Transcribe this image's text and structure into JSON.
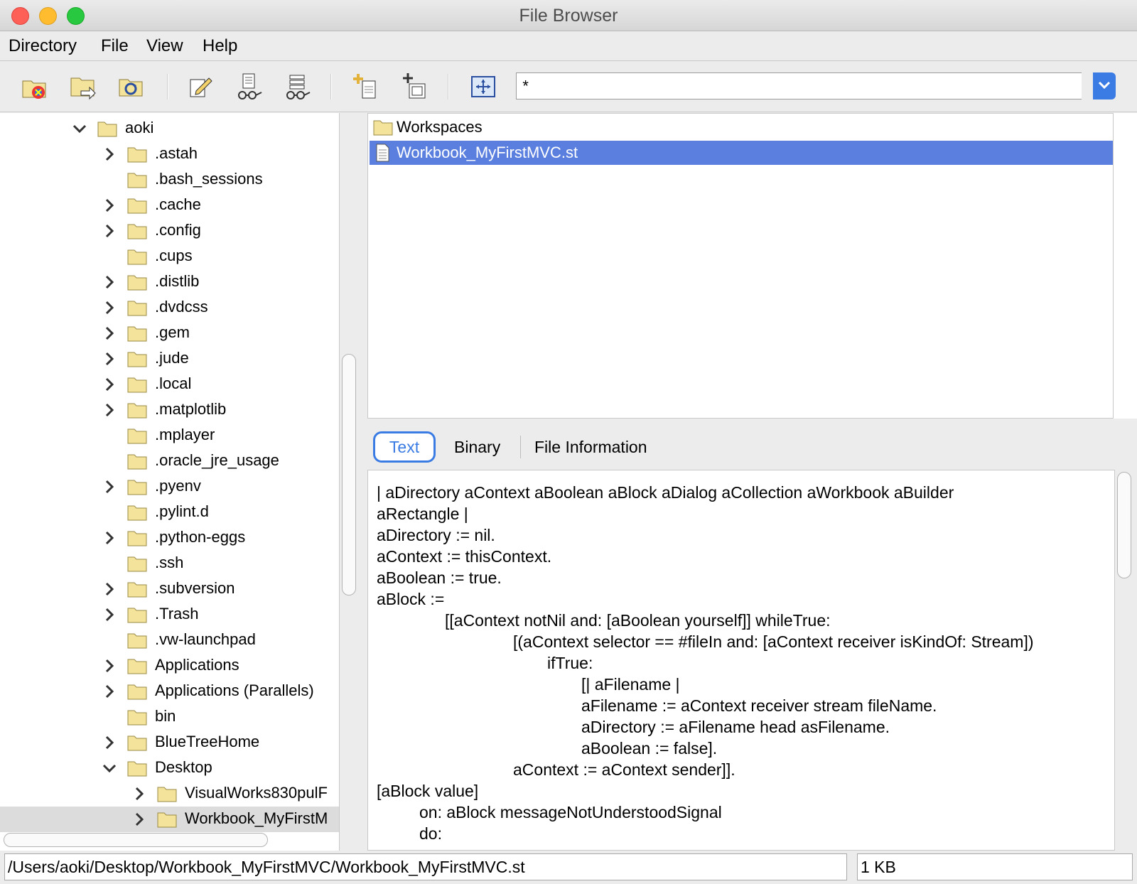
{
  "window": {
    "title": "File Browser"
  },
  "menu": [
    "Directory",
    "File",
    "View",
    "Help"
  ],
  "toolbar": {
    "filter_value": "*",
    "buttons": [
      "favorites-icon",
      "go-directory-icon",
      "refresh-directory-icon",
      "edit-icon",
      "inspect-file-icon",
      "inspect-directory-icon",
      "new-file-icon",
      "new-directory-icon",
      "fit-icon"
    ]
  },
  "tree": {
    "items": [
      {
        "label": "aoki",
        "arrow": "down"
      },
      {
        "label": ".astah",
        "arrow": "right"
      },
      {
        "label": ".bash_sessions",
        "arrow": ""
      },
      {
        "label": ".cache",
        "arrow": "right"
      },
      {
        "label": ".config",
        "arrow": "right"
      },
      {
        "label": ".cups",
        "arrow": ""
      },
      {
        "label": ".distlib",
        "arrow": "right"
      },
      {
        "label": ".dvdcss",
        "arrow": "right"
      },
      {
        "label": ".gem",
        "arrow": "right"
      },
      {
        "label": ".jude",
        "arrow": "right"
      },
      {
        "label": ".local",
        "arrow": "right"
      },
      {
        "label": ".matplotlib",
        "arrow": "right"
      },
      {
        "label": ".mplayer",
        "arrow": ""
      },
      {
        "label": ".oracle_jre_usage",
        "arrow": ""
      },
      {
        "label": ".pyenv",
        "arrow": "right"
      },
      {
        "label": ".pylint.d",
        "arrow": ""
      },
      {
        "label": ".python-eggs",
        "arrow": "right"
      },
      {
        "label": ".ssh",
        "arrow": ""
      },
      {
        "label": ".subversion",
        "arrow": "right"
      },
      {
        "label": ".Trash",
        "arrow": "right"
      },
      {
        "label": ".vw-launchpad",
        "arrow": ""
      },
      {
        "label": "Applications",
        "arrow": "right"
      },
      {
        "label": "Applications (Parallels)",
        "arrow": "right"
      },
      {
        "label": "bin",
        "arrow": ""
      },
      {
        "label": "BlueTreeHome",
        "arrow": "right"
      },
      {
        "label": "Desktop",
        "arrow": "down"
      },
      {
        "label": "VisualWorks830pulF",
        "arrow": "right"
      },
      {
        "label": "Workbook_MyFirstM",
        "arrow": "right",
        "selected": true
      }
    ]
  },
  "files": [
    {
      "label": "Workspaces",
      "type": "folder"
    },
    {
      "label": "Workbook_MyFirstMVC.st",
      "type": "file",
      "selected": true
    }
  ],
  "tabs": {
    "text": "Text",
    "binary": "Binary",
    "info": "File Information"
  },
  "code_lines": [
    "| aDirectory aContext aBoolean aBlock aDialog aCollection aWorkbook aBuilder",
    "aRectangle |",
    "aDirectory := nil.",
    "aContext := thisContext.",
    "aBoolean := true.",
    "aBlock :=",
    "[[aContext notNil and: [aBoolean yourself]] whileTrue:",
    "[(aContext selector == #fileIn and: [aContext receiver isKindOf: Stream])",
    "ifTrue:",
    "[| aFilename |",
    "aFilename := aContext receiver stream fileName.",
    "aDirectory := aFilename head asFilename.",
    "aBoolean := false].",
    "aContext := aContext sender]].",
    "[aBlock value]",
    "on: aBlock messageNotUnderstoodSignal",
    "do:"
  ],
  "status": {
    "path": "/Users/aoki/Desktop/Workbook_MyFirstMVC/Workbook_MyFirstMVC.st",
    "size": "1 KB"
  }
}
